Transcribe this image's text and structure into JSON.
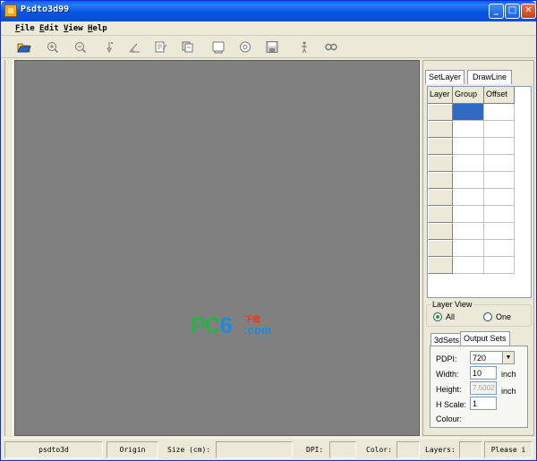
{
  "window": {
    "title": "Psdto3d99"
  },
  "menu": [
    {
      "accel": "F",
      "rest": "ile"
    },
    {
      "accel": "E",
      "rest": "dit"
    },
    {
      "accel": "V",
      "rest": "iew"
    },
    {
      "accel": "H",
      "rest": "elp"
    }
  ],
  "toolbar_icons": [
    "open-folder-icon",
    "zoom-in-icon",
    "zoom-out-icon",
    "pointer-icon",
    "angle-icon",
    "layer-edit-icon",
    "layer-copy-icon",
    "frame-icon",
    "circle-icon",
    "save-icon",
    "figure-icon",
    "link-icon"
  ],
  "watermark": {
    "pc": "PC",
    "six": "6",
    "cn": "下载",
    "com": ".com"
  },
  "right_panel": {
    "tabs": {
      "setlayer": "SetLayer",
      "drawline": "DrawLine"
    },
    "grid": {
      "headers": [
        "Layer",
        "Group",
        "Offset"
      ],
      "row_count": 10
    },
    "layer_view": {
      "legend": "Layer View",
      "all": "All",
      "one": "One",
      "selected": "All"
    },
    "settings_tabs": {
      "3dsets": "3dSets",
      "output": "Output Sets"
    },
    "settings": {
      "pdpi_label": "PDPI:",
      "pdpi_value": "720",
      "width_label": "Width:",
      "width_value": "10",
      "width_unit": "inch",
      "height_label": "Height:",
      "height_value": "7.5002",
      "height_unit": "inch",
      "hscale_label": "H Scale:",
      "hscale_value": "1",
      "colour_label": "Colour:"
    }
  },
  "statusbar": {
    "app": "psdto3d",
    "origin": "Origin",
    "size": "Size (cm):",
    "dpi": "DPI:",
    "color": "Color:",
    "layers": "Layers:",
    "please": "Please i"
  }
}
